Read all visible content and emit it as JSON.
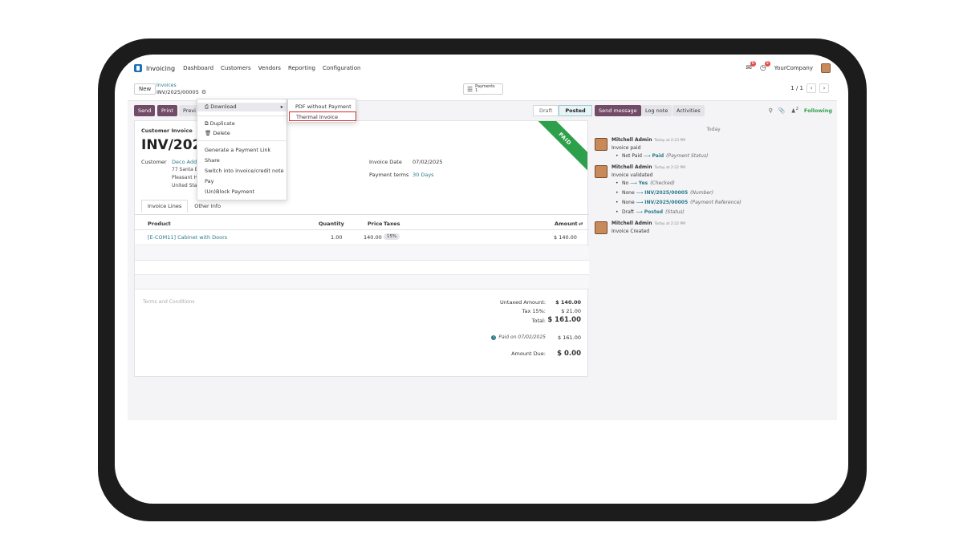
{
  "navbar": {
    "app_name": "Invoicing",
    "menu": [
      "Dashboard",
      "Customers",
      "Vendors",
      "Reporting",
      "Configuration"
    ],
    "company": "YourCompany",
    "msg_badge": "8",
    "activity_badge": "9"
  },
  "control": {
    "new_label": "New",
    "breadcrumb_parent": "Invoices",
    "breadcrumb_current": "INV/2025/00005",
    "smart_payments_label": "Payments",
    "smart_payments_count": "1",
    "pager": "1 / 1"
  },
  "actions": {
    "send": "Send",
    "print": "Print",
    "preview": "Previ"
  },
  "status": {
    "stages": [
      "Draft",
      "Posted"
    ],
    "active": "Posted"
  },
  "dropdown": {
    "download": "Download",
    "duplicate": "Duplicate",
    "delete": "Delete",
    "items": [
      "Generate a Payment Link",
      "Share",
      "Switch into invoice/credit note",
      "Pay",
      "(Un)Block Payment"
    ],
    "submenu": [
      "PDF without Payment",
      "Thermal Invoice"
    ]
  },
  "form": {
    "ribbon": "PAID",
    "type_label": "Customer Invoice",
    "title": "INV/2025",
    "customer_label": "Customer",
    "customer_name": "Deco Addi",
    "address": [
      "77 Santa B",
      "Pleasant H",
      "United Sta"
    ],
    "invoice_date_label": "Invoice Date",
    "invoice_date": "07/02/2025",
    "payment_terms_label": "Payment terms",
    "payment_terms": "30 Days",
    "tabs": [
      "Invoice Lines",
      "Other Info"
    ],
    "columns": {
      "product": "Product",
      "quantity": "Quantity",
      "price": "Price",
      "taxes": "Taxes",
      "amount": "Amount"
    },
    "line": {
      "product": "[E-COM11] Cabinet with Doors",
      "quantity": "1.00",
      "price": "140.00",
      "tax": "15%",
      "amount": "$ 140.00"
    },
    "terms_placeholder": "Terms and Conditions",
    "totals": {
      "untaxed_label": "Untaxed Amount:",
      "untaxed": "$ 140.00",
      "tax_label": "Tax 15%:",
      "tax": "$ 21.00",
      "total_label": "Total:",
      "total": "$ 161.00",
      "paid_on": "Paid on 07/02/2025",
      "paid_amount": "$ 161.00",
      "due_label": "Amount Due:",
      "due": "$ 0.00"
    }
  },
  "chatter": {
    "send_message": "Send message",
    "log_note": "Log note",
    "activities": "Activities",
    "attach_count": "2",
    "following": "Following",
    "today": "Today",
    "msg1": {
      "author": "Mitchell Admin",
      "time": "Today at 2:23 PM",
      "text": "Invoice paid",
      "t1_old": "Not Paid",
      "t1_new": "Paid",
      "t1_field": "(Payment Status)"
    },
    "msg2": {
      "author": "Mitchell Admin",
      "time": "Today at 2:22 PM",
      "text": "Invoice validated",
      "t1_old": "No",
      "t1_new": "Yes",
      "t1_field": "(Checked)",
      "t2_old": "None",
      "t2_new": "INV/2025/00005",
      "t2_field": "(Number)",
      "t3_old": "None",
      "t3_new": "INV/2025/00005",
      "t3_field": "(Payment Reference)",
      "t4_old": "Draft",
      "t4_new": "Posted",
      "t4_field": "(Status)"
    },
    "msg3": {
      "author": "Mitchell Admin",
      "time": "Today at 2:22 PM",
      "text": "Invoice Created"
    }
  }
}
